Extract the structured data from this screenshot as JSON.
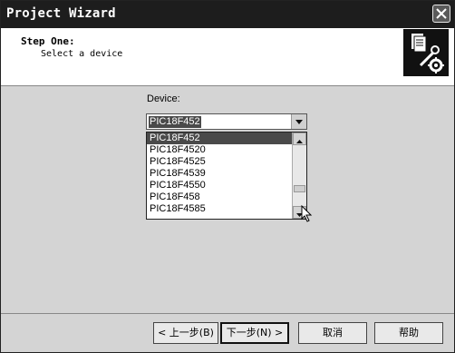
{
  "window": {
    "title": "Project Wizard"
  },
  "header": {
    "step_title": "Step One:",
    "step_subtitle": "Select a device"
  },
  "device": {
    "label": "Device:",
    "selected_value": "PIC18F452",
    "options": [
      "PIC18F452",
      "PIC18F4520",
      "PIC18F4525",
      "PIC18F4539",
      "PIC18F4550",
      "PIC18F458",
      "PIC18F4585"
    ]
  },
  "buttons": {
    "back": "< 上一步(B)",
    "next": "下一步(N) >",
    "cancel": "取消",
    "help": "帮助"
  }
}
